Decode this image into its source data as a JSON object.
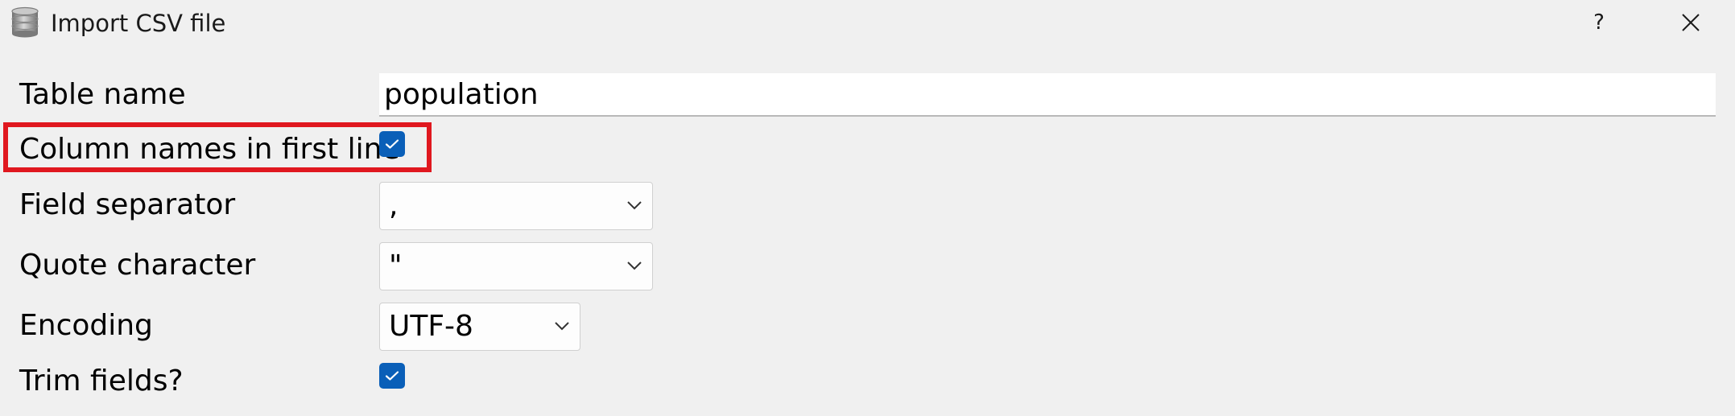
{
  "window": {
    "title": "Import CSV file",
    "help_label": "?",
    "app_icon": "database-icon",
    "close_icon": "close-icon"
  },
  "form": {
    "table_name": {
      "label": "Table name",
      "value": "population"
    },
    "column_names": {
      "label": "Column names in first line",
      "checked": true
    },
    "field_separator": {
      "label": "Field separator",
      "value": ","
    },
    "quote_character": {
      "label": "Quote character",
      "value": "\""
    },
    "encoding": {
      "label": "Encoding",
      "value": "UTF-8"
    },
    "trim_fields": {
      "label": "Trim fields?",
      "checked": true
    }
  },
  "colors": {
    "checkbox": "#0a5fb8",
    "highlight": "#e0181f",
    "background": "#f0f0f0"
  }
}
